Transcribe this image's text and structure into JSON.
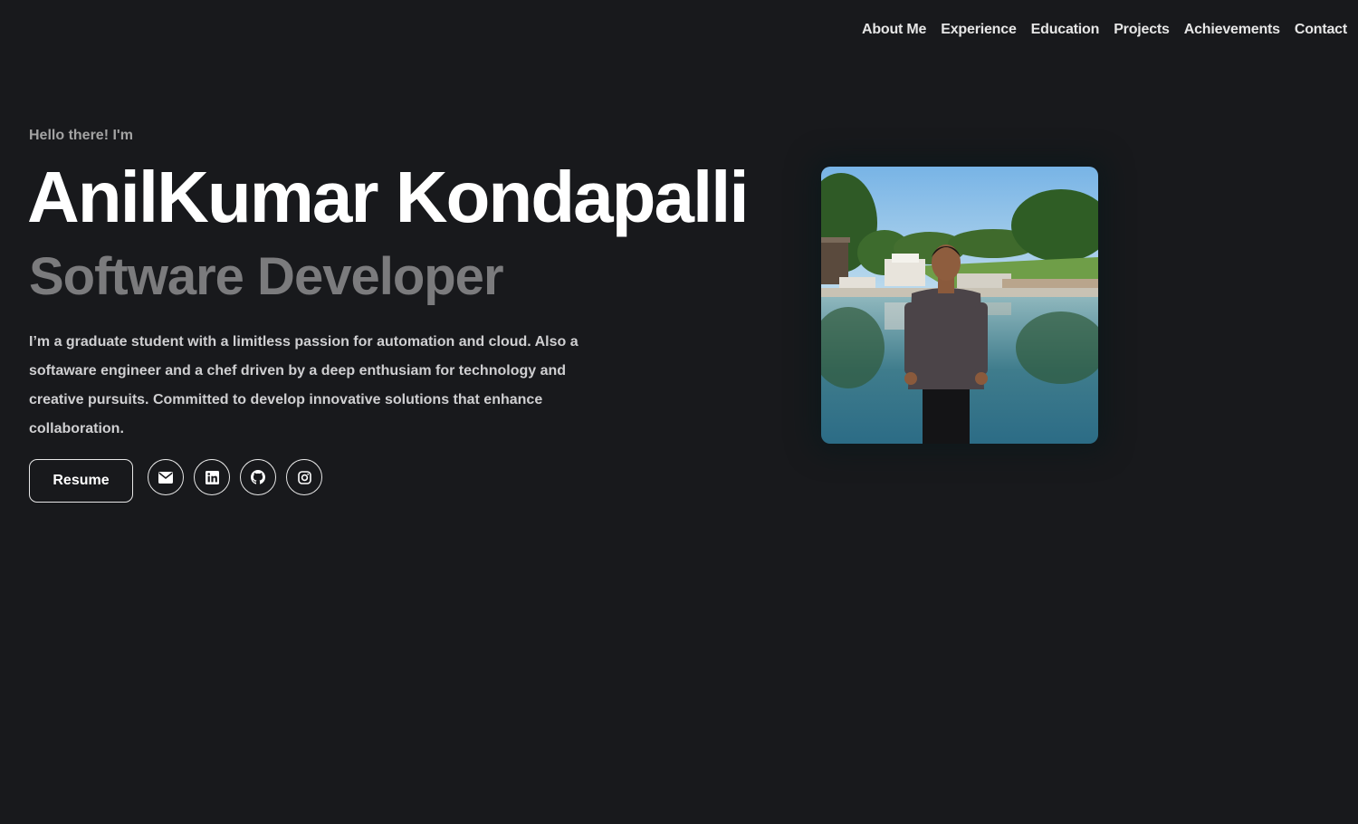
{
  "nav": {
    "items": [
      "About Me",
      "Experience",
      "Education",
      "Projects",
      "Achievements",
      "Contact"
    ]
  },
  "hero": {
    "greeting": "Hello there! I'm",
    "name": "AnilKumar Kondapalli",
    "role": "Software Developer",
    "bio": "I’m a graduate student with a limitless passion for automation and cloud. Also a softaware engineer and a chef driven by a deep enthusiam for technology and creative pursuits. Committed to develop innovative solutions that enhance collaboration."
  },
  "actions": {
    "resume_label": "Resume",
    "socials": [
      {
        "icon": "envelope-icon"
      },
      {
        "icon": "linkedin-icon"
      },
      {
        "icon": "github-icon"
      },
      {
        "icon": "instagram-icon"
      }
    ]
  },
  "colors": {
    "background": "#18191c",
    "text": "#ffffff",
    "muted": "#7b7b7d",
    "greeting": "#a3a3a3",
    "bio": "#cfcfd1",
    "border": "#e8e8e8"
  }
}
